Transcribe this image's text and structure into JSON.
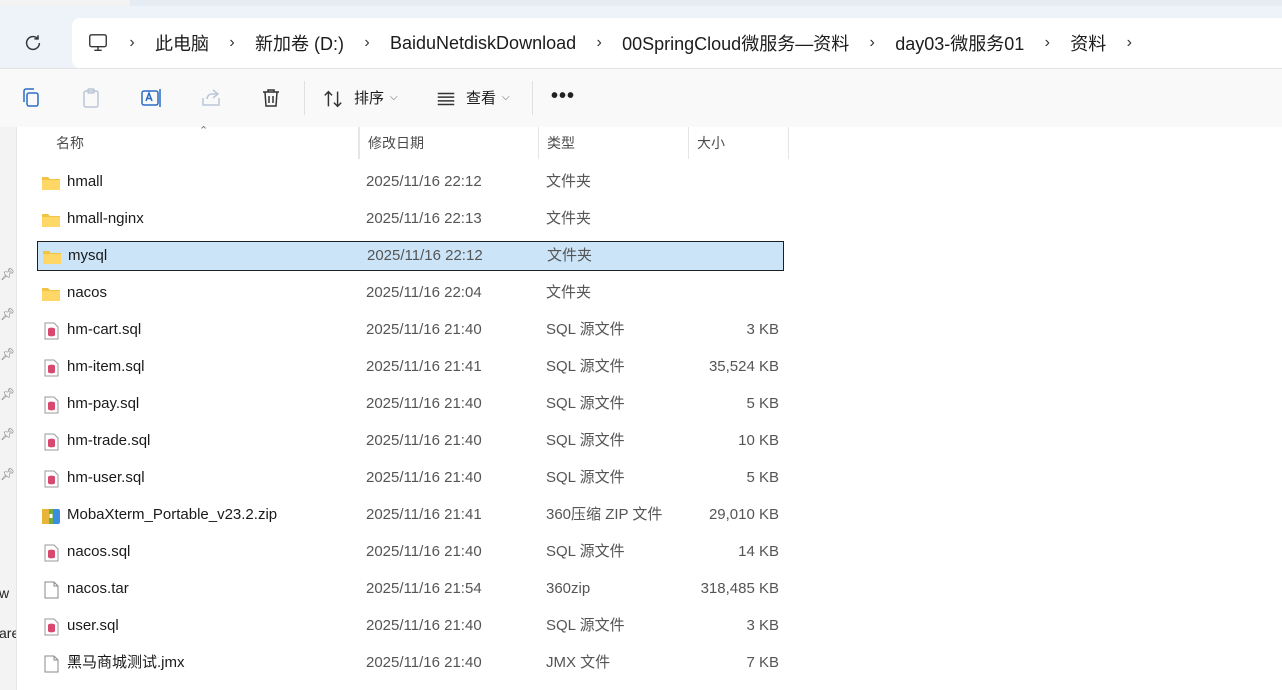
{
  "breadcrumbs": [
    "此电脑",
    "新加卷 (D:)",
    "BaiduNetdiskDownload",
    "00SpringCloud微服务—资料",
    "day03-微服务01",
    "资料"
  ],
  "toolbar": {
    "sort_label": "排序",
    "view_label": "查看",
    "more_label": "•••"
  },
  "left_fragments": [
    "w",
    "are"
  ],
  "columns": {
    "name": "名称",
    "date": "修改日期",
    "type": "类型",
    "size": "大小"
  },
  "files": [
    {
      "name": "hmall",
      "date": "2025/11/16 22:12",
      "type": "文件夹",
      "size": "",
      "icon": "folder-icon"
    },
    {
      "name": "hmall-nginx",
      "date": "2025/11/16 22:13",
      "type": "文件夹",
      "size": "",
      "icon": "folder-icon"
    },
    {
      "name": "mysql",
      "date": "2025/11/16 22:12",
      "type": "文件夹",
      "size": "",
      "icon": "folder-icon",
      "selected": true
    },
    {
      "name": "nacos",
      "date": "2025/11/16 22:04",
      "type": "文件夹",
      "size": "",
      "icon": "folder-icon"
    },
    {
      "name": "hm-cart.sql",
      "date": "2025/11/16 21:40",
      "type": "SQL 源文件",
      "size": "3 KB",
      "icon": "sql-file-icon"
    },
    {
      "name": "hm-item.sql",
      "date": "2025/11/16 21:41",
      "type": "SQL 源文件",
      "size": "35,524 KB",
      "icon": "sql-file-icon"
    },
    {
      "name": "hm-pay.sql",
      "date": "2025/11/16 21:40",
      "type": "SQL 源文件",
      "size": "5 KB",
      "icon": "sql-file-icon"
    },
    {
      "name": "hm-trade.sql",
      "date": "2025/11/16 21:40",
      "type": "SQL 源文件",
      "size": "10 KB",
      "icon": "sql-file-icon"
    },
    {
      "name": "hm-user.sql",
      "date": "2025/11/16 21:40",
      "type": "SQL 源文件",
      "size": "5 KB",
      "icon": "sql-file-icon"
    },
    {
      "name": "MobaXterm_Portable_v23.2.zip",
      "date": "2025/11/16 21:41",
      "type": "360压缩 ZIP 文件",
      "size": "29,010 KB",
      "icon": "zip-archive-icon"
    },
    {
      "name": "nacos.sql",
      "date": "2025/11/16 21:40",
      "type": "SQL 源文件",
      "size": "14 KB",
      "icon": "sql-file-icon"
    },
    {
      "name": "nacos.tar",
      "date": "2025/11/16 21:54",
      "type": "360zip",
      "size": "318,485 KB",
      "icon": "blank-file-icon"
    },
    {
      "name": "user.sql",
      "date": "2025/11/16 21:40",
      "type": "SQL 源文件",
      "size": "3 KB",
      "icon": "sql-file-icon"
    },
    {
      "name": "黑马商城测试.jmx",
      "date": "2025/11/16 21:40",
      "type": "JMX 文件",
      "size": "7 KB",
      "icon": "blank-file-icon"
    }
  ],
  "colors": {
    "selection_bg": "#cce4f7",
    "folder": "#f3c443",
    "sql_icon": "#d9486e"
  }
}
